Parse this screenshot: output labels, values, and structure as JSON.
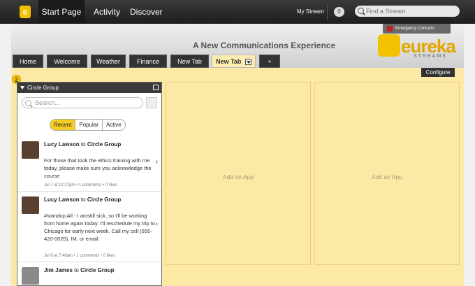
{
  "topnav": {
    "logo_letter": "e",
    "items": [
      "Start Page",
      "Activity",
      "Discover"
    ],
    "mystream_label": "My Stream",
    "count": "0",
    "find_placeholder": "Find a Stream"
  },
  "header": {
    "title": "A New Communications Experience",
    "emergency": "Emergency Contacts",
    "brand_name": "eureka",
    "brand_sub": "STREAMS"
  },
  "tabs": [
    "Home",
    "Welcome",
    "Weather",
    "Finance",
    "New Tab",
    "New Tab",
    "+"
  ],
  "configure": "Configure",
  "column_number": "2",
  "widget": {
    "title": "Circle Group",
    "search_placeholder": "Search...",
    "filters": [
      "Recent",
      "Popular",
      "Active"
    ],
    "posts": [
      {
        "author": "Lucy Lawson",
        "to_word": "to",
        "group": "Circle Group",
        "body": "For those that took the ethics training with me today, please make sure you acknowledge the course",
        "meta": "Jul 7 at 12:27pm • 1 comments • 0 likes"
      },
      {
        "author": "Lucy Lawson",
        "to_word": "to",
        "group": "Circle Group",
        "body": "#standup All - I amstill sick, so I'll be working from home again today. I'll reschedule my trip to Chicago for early next week. Call my cell (555-420-0020), IM, or email.",
        "meta": "Jul 6 at 7:48am • 1 comments • 0 likes"
      },
      {
        "author": "Jim James",
        "to_word": "to",
        "group": "Circle Group",
        "body": "",
        "meta": ""
      }
    ]
  },
  "slots": [
    "Add an App",
    "Add an App"
  ]
}
